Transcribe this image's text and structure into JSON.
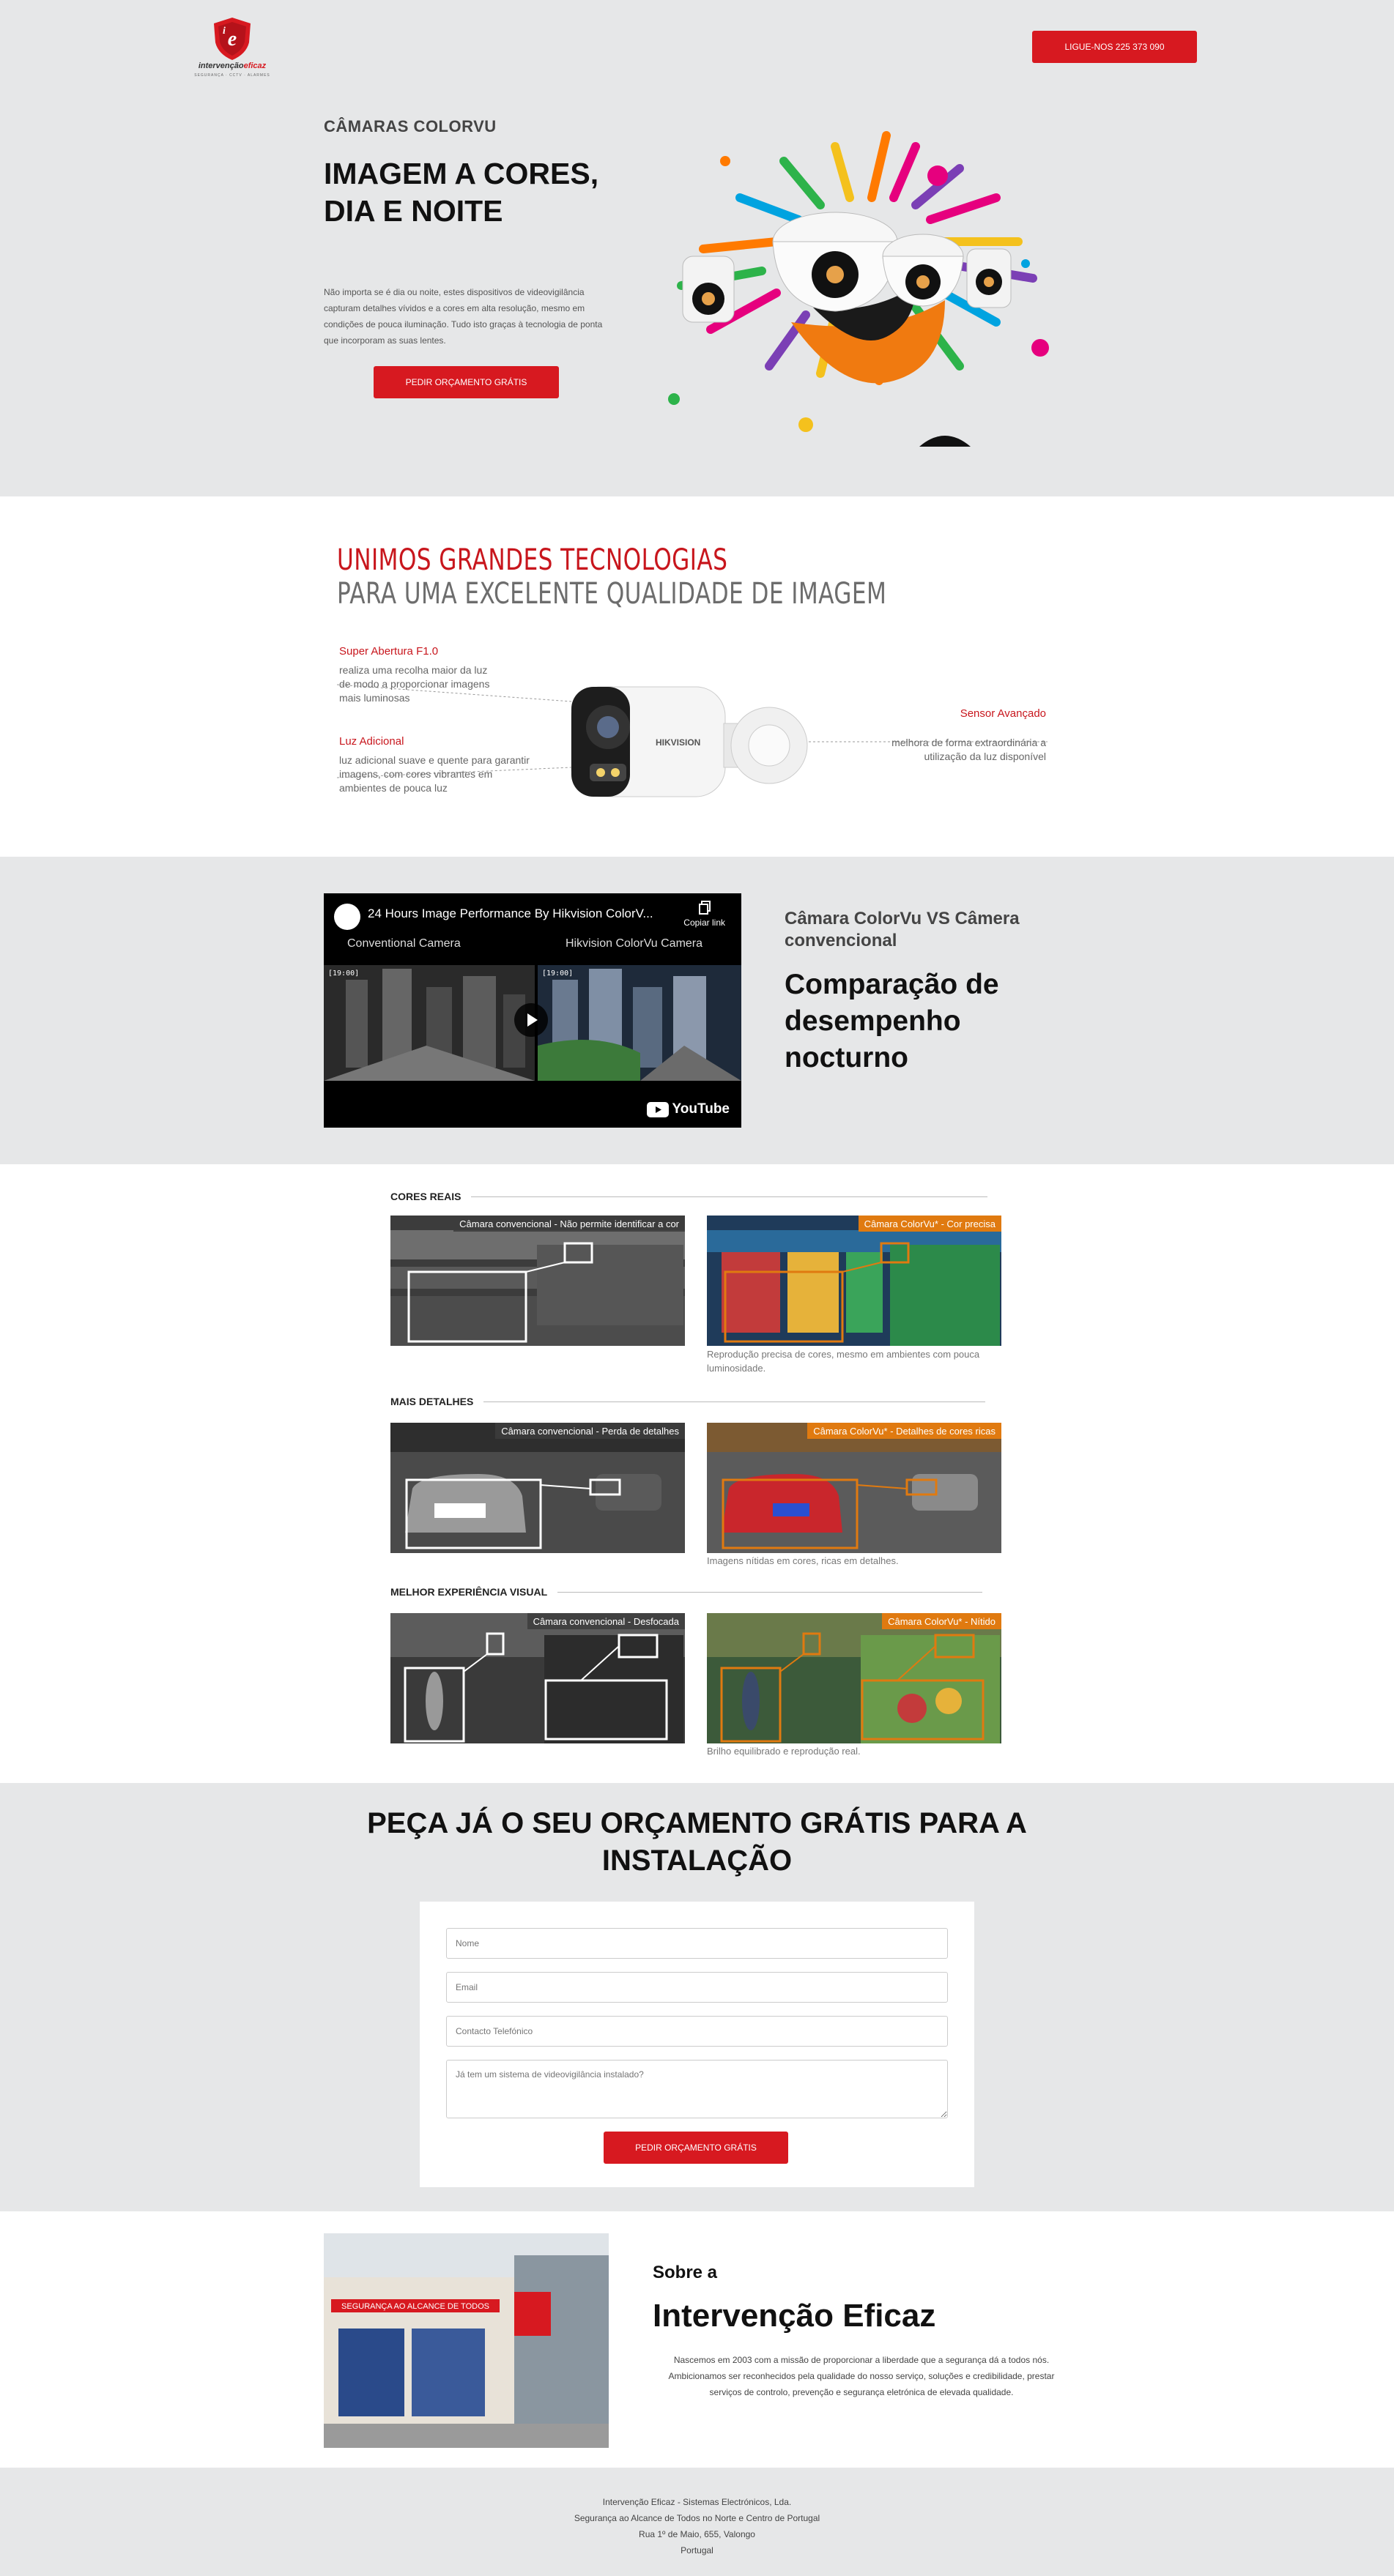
{
  "header": {
    "logo_text_main": "intervenção",
    "logo_text_accent": "eficaz",
    "logo_tagline": "SEGURANÇA · CCTV · ALARMES",
    "call_button": "LIGUE-NOS 225 373 090"
  },
  "hero": {
    "kicker": "CÂMARAS COLORVU",
    "title": "IMAGEM A CORES, DIA E NOITE",
    "text": "Não importa se é dia ou noite, estes dispositivos de videovigilância capturam detalhes vívidos e a cores em alta resolução, mesmo em condições de pouca iluminação. Tudo isto graças à tecnologia de ponta que incorporam as suas lentes.",
    "cta": "PEDIR ORÇAMENTO GRÁTIS"
  },
  "tech": {
    "headline_1": "UNIMOS GRANDES TECNOLOGIAS",
    "headline_2": "PARA UMA EXCELENTE QUALIDADE DE IMAGEM",
    "features": [
      {
        "title": "Super Abertura F1.0",
        "text": "realiza uma recolha maior da luz de modo a proporcionar imagens mais luminosas"
      },
      {
        "title": "Luz Adicional",
        "text": "luz adicional suave e quente para garantir imagens, com cores vibrantes em ambientes de pouca luz"
      },
      {
        "title": "Sensor Avançado",
        "text": "melhora de forma extraordinária a utilização da luz disponível"
      }
    ],
    "camera_brand": "HIKVISION"
  },
  "compare": {
    "video_title": "24 Hours Image Performance By Hikvision ColorV...",
    "copy_link": "Copiar link",
    "label_left": "Conventional Camera",
    "label_right": "Hikvision  ColorVu Camera",
    "timestamp": "[19:00]",
    "youtube": "YouTube",
    "subtitle": "Câmara ColorVu VS Câmera convencional",
    "title": "Comparação de desempenho nocturno"
  },
  "grid": {
    "rows": [
      {
        "heading": "CORES REAIS",
        "left_caption": "Câmara convencional - Não permite identificar a cor",
        "right_caption": "Câmara ColorVu* - Cor precisa",
        "note": "Reprodução precisa de cores, mesmo em ambientes com pouca luminosidade."
      },
      {
        "heading": "MAIS DETALHES",
        "left_caption": "Câmara convencional - Perda de detalhes",
        "right_caption": "Câmara ColorVu*  - Detalhes de cores ricas",
        "note": "Imagens nítidas em cores, ricas em detalhes."
      },
      {
        "heading": "MELHOR EXPERIÊNCIA VISUAL",
        "left_caption": "Câmara convencional - Desfocada",
        "right_caption": "Câmara ColorVu*  - Nítido",
        "note": "Brilho equilibrado e reprodução real."
      }
    ]
  },
  "quote": {
    "title": "PEÇA JÁ O SEU ORÇAMENTO GRÁTIS PARA A INSTALAÇÃO",
    "name_placeholder": "Nome",
    "email_placeholder": "Email",
    "phone_placeholder": "Contacto Telefónico",
    "message_placeholder": "Já tem um sistema de videovigilância instalado?",
    "submit": "PEDIR ORÇAMENTO GRÁTIS"
  },
  "about": {
    "subtitle": "Sobre a",
    "title": "Intervenção Eficaz",
    "text": "Nascemos em 2003 com a missão de proporcionar a liberdade que a segurança dá a todos nós. Ambicionamos ser reconhecidos pela qualidade do nosso serviço, soluções e credibilidade, prestar serviços de controlo, prevenção e segurança eletrónica de elevada qualidade.",
    "shop_sign": "SEGURANÇA AO ALCANCE DE TODOS"
  },
  "footer": {
    "company": "Intervenção Eficaz - Sistemas Electrónicos, Lda.",
    "slogan": "Segurança ao Alcance de Todos no Norte e Centro de Portugal",
    "address": "Rua 1º de Maio, 655, Valongo",
    "country": "Portugal"
  },
  "colors": {
    "brand_red": "#d71920",
    "section_gray": "#e6e7e8",
    "colorvu_orange": "#e07a10"
  }
}
